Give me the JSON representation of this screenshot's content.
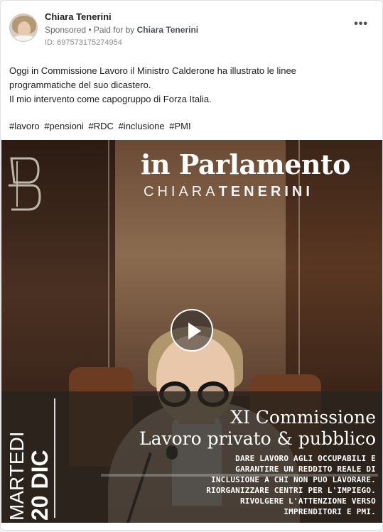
{
  "post": {
    "author": "Chiara Tenerini",
    "sponsored_label": "Sponsored",
    "paid_for_by_prefix": "• Paid for by",
    "paid_for_by_name": "Chiara Tenerini",
    "ad_id": "ID: 697573175274954",
    "more_icon_glyph": "•••",
    "text_lines": [
      "Oggi in Commissione Lavoro il Ministro Calderone ha illustrato le linee",
      "programmatiche del suo dicastero.",
      "Il mio intervento come capogruppo di Forza Italia."
    ],
    "hashtags": [
      "#lavoro",
      "#pensioni",
      "#RDC",
      "#inclusione",
      "#PMI"
    ]
  },
  "video": {
    "show_title": "in Parlamento",
    "name_first": "CHIARA",
    "name_last": "TENERINI",
    "weekday": "MARTEDI",
    "date": "20 DIC",
    "commission_title": "XI Commissione",
    "commission_subtitle": "Lavoro privato & pubblico",
    "description_lines": [
      "DARE LAVORO AGLI OCCUPABILI E",
      "GARANTIRE UN REDDITO REALE DI",
      "INCLUSIONE A CHI NON PUO LAVORARE.",
      "RIORGANIZZARE CENTRI PER L'IMPIEGO.",
      "RIVOLGERE L'ATTENZIONE VERSO",
      "IMPRENDITORI E PMI."
    ],
    "play_icon": "play-icon"
  },
  "colors": {
    "card_bg": "#ffffff",
    "meta_gray": "#65676b",
    "overlay_text": "#ffffff"
  }
}
